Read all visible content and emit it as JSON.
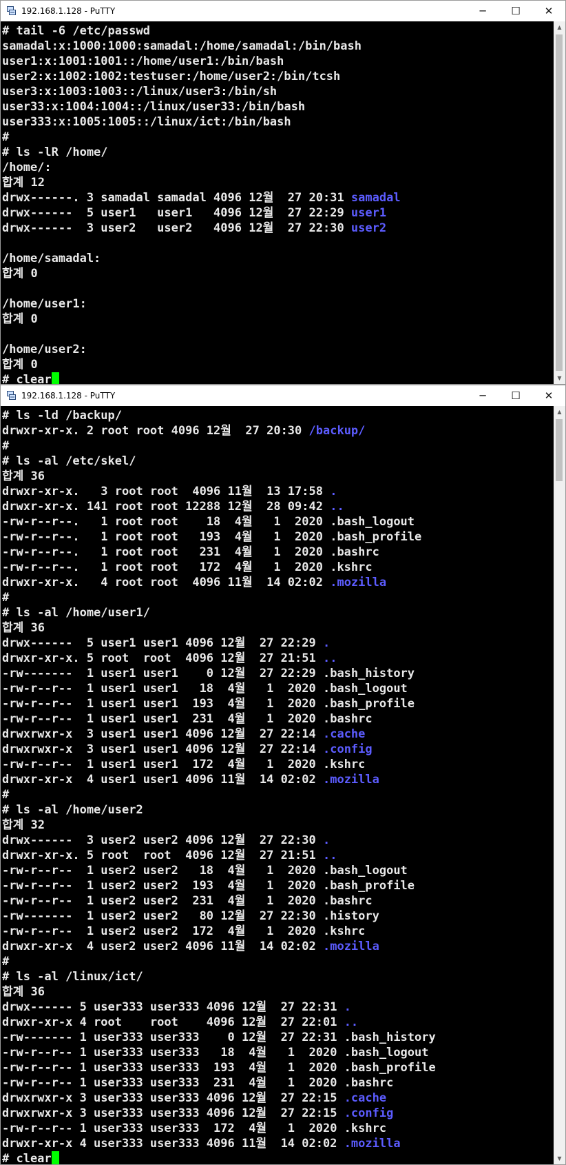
{
  "windows": [
    {
      "title": "192.168.1.128 - PuTTY",
      "controls": {
        "minimize": "─",
        "maximize": "☐",
        "close": "✕"
      },
      "lines": [
        {
          "text": "# tail -6 /etc/passwd"
        },
        {
          "text": "samadal:x:1000:1000:samadal:/home/samadal:/bin/bash"
        },
        {
          "text": "user1:x:1001:1001::/home/user1:/bin/bash"
        },
        {
          "text": "user2:x:1002:1002:testuser:/home/user2:/bin/tcsh"
        },
        {
          "text": "user3:x:1003:1003::/linux/user3:/bin/sh"
        },
        {
          "text": "user33:x:1004:1004::/linux/user33:/bin/bash"
        },
        {
          "text": "user333:x:1005:1005::/linux/ict:/bin/bash"
        },
        {
          "text": "#"
        },
        {
          "text": "# ls -lR /home/"
        },
        {
          "text": "/home/:"
        },
        {
          "text": "합계 12"
        },
        {
          "text": "drwx------. 3 samadal samadal 4096 12월  27 20:31 ",
          "dir": "samadal"
        },
        {
          "text": "drwx------  5 user1   user1   4096 12월  27 22:29 ",
          "dir": "user1"
        },
        {
          "text": "drwx------  3 user2   user2   4096 12월  27 22:30 ",
          "dir": "user2"
        },
        {
          "text": ""
        },
        {
          "text": "/home/samadal:"
        },
        {
          "text": "합계 0"
        },
        {
          "text": ""
        },
        {
          "text": "/home/user1:"
        },
        {
          "text": "합계 0"
        },
        {
          "text": ""
        },
        {
          "text": "/home/user2:"
        },
        {
          "text": "합계 0"
        },
        {
          "text": "# clear",
          "cursor": true
        }
      ]
    },
    {
      "title": "192.168.1.128 - PuTTY",
      "controls": {
        "minimize": "─",
        "maximize": "☐",
        "close": "✕"
      },
      "lines": [
        {
          "text": "# ls -ld /backup/"
        },
        {
          "text": "drwxr-xr-x. 2 root root 4096 12월  27 20:30 ",
          "dir": "/backup/"
        },
        {
          "text": "#"
        },
        {
          "text": "# ls -al /etc/skel/"
        },
        {
          "text": "합계 36"
        },
        {
          "text": "drwxr-xr-x.   3 root root  4096 11월  13 17:58 ",
          "dir": "."
        },
        {
          "text": "drwxr-xr-x. 141 root root 12288 12월  28 09:42 ",
          "dir": ".."
        },
        {
          "text": "-rw-r--r--.   1 root root    18  4월   1  2020 .bash_logout"
        },
        {
          "text": "-rw-r--r--.   1 root root   193  4월   1  2020 .bash_profile"
        },
        {
          "text": "-rw-r--r--.   1 root root   231  4월   1  2020 .bashrc"
        },
        {
          "text": "-rw-r--r--.   1 root root   172  4월   1  2020 .kshrc"
        },
        {
          "text": "drwxr-xr-x.   4 root root  4096 11월  14 02:02 ",
          "dir": ".mozilla"
        },
        {
          "text": "#"
        },
        {
          "text": "# ls -al /home/user1/"
        },
        {
          "text": "합계 36"
        },
        {
          "text": "drwx------  5 user1 user1 4096 12월  27 22:29 ",
          "dir": "."
        },
        {
          "text": "drwxr-xr-x. 5 root  root  4096 12월  27 21:51 ",
          "dir": ".."
        },
        {
          "text": "-rw-------  1 user1 user1    0 12월  27 22:29 .bash_history"
        },
        {
          "text": "-rw-r--r--  1 user1 user1   18  4월   1  2020 .bash_logout"
        },
        {
          "text": "-rw-r--r--  1 user1 user1  193  4월   1  2020 .bash_profile"
        },
        {
          "text": "-rw-r--r--  1 user1 user1  231  4월   1  2020 .bashrc"
        },
        {
          "text": "drwxrwxr-x  3 user1 user1 4096 12월  27 22:14 ",
          "dir": ".cache"
        },
        {
          "text": "drwxrwxr-x  3 user1 user1 4096 12월  27 22:14 ",
          "dir": ".config"
        },
        {
          "text": "-rw-r--r--  1 user1 user1  172  4월   1  2020 .kshrc"
        },
        {
          "text": "drwxr-xr-x  4 user1 user1 4096 11월  14 02:02 ",
          "dir": ".mozilla"
        },
        {
          "text": "#"
        },
        {
          "text": "# ls -al /home/user2"
        },
        {
          "text": "합계 32"
        },
        {
          "text": "drwx------  3 user2 user2 4096 12월  27 22:30 ",
          "dir": "."
        },
        {
          "text": "drwxr-xr-x. 5 root  root  4096 12월  27 21:51 ",
          "dir": ".."
        },
        {
          "text": "-rw-r--r--  1 user2 user2   18  4월   1  2020 .bash_logout"
        },
        {
          "text": "-rw-r--r--  1 user2 user2  193  4월   1  2020 .bash_profile"
        },
        {
          "text": "-rw-r--r--  1 user2 user2  231  4월   1  2020 .bashrc"
        },
        {
          "text": "-rw-------  1 user2 user2   80 12월  27 22:30 .history"
        },
        {
          "text": "-rw-r--r--  1 user2 user2  172  4월   1  2020 .kshrc"
        },
        {
          "text": "drwxr-xr-x  4 user2 user2 4096 11월  14 02:02 ",
          "dir": ".mozilla"
        },
        {
          "text": "#"
        },
        {
          "text": "# ls -al /linux/ict/"
        },
        {
          "text": "합계 36"
        },
        {
          "text": "drwx------ 5 user333 user333 4096 12월  27 22:31 ",
          "dir": "."
        },
        {
          "text": "drwxr-xr-x 4 root    root    4096 12월  27 22:01 ",
          "dir": ".."
        },
        {
          "text": "-rw------- 1 user333 user333    0 12월  27 22:31 .bash_history"
        },
        {
          "text": "-rw-r--r-- 1 user333 user333   18  4월   1  2020 .bash_logout"
        },
        {
          "text": "-rw-r--r-- 1 user333 user333  193  4월   1  2020 .bash_profile"
        },
        {
          "text": "-rw-r--r-- 1 user333 user333  231  4월   1  2020 .bashrc"
        },
        {
          "text": "drwxrwxr-x 3 user333 user333 4096 12월  27 22:15 ",
          "dir": ".cache"
        },
        {
          "text": "drwxrwxr-x 3 user333 user333 4096 12월  27 22:15 ",
          "dir": ".config"
        },
        {
          "text": "-rw-r--r-- 1 user333 user333  172  4월   1  2020 .kshrc"
        },
        {
          "text": "drwxr-xr-x 4 user333 user333 4096 11월  14 02:02 ",
          "dir": ".mozilla"
        },
        {
          "text": "# clear",
          "cursor": true
        }
      ]
    }
  ],
  "colors": {
    "terminal_bg": "#000000",
    "terminal_fg": "#e8e8e8",
    "directory": "#5c5cff",
    "cursor": "#00ff00"
  },
  "icons": {
    "app": "putty-icon",
    "scroll_up": "scroll-up-arrow-icon",
    "scroll_down": "scroll-down-arrow-icon"
  }
}
